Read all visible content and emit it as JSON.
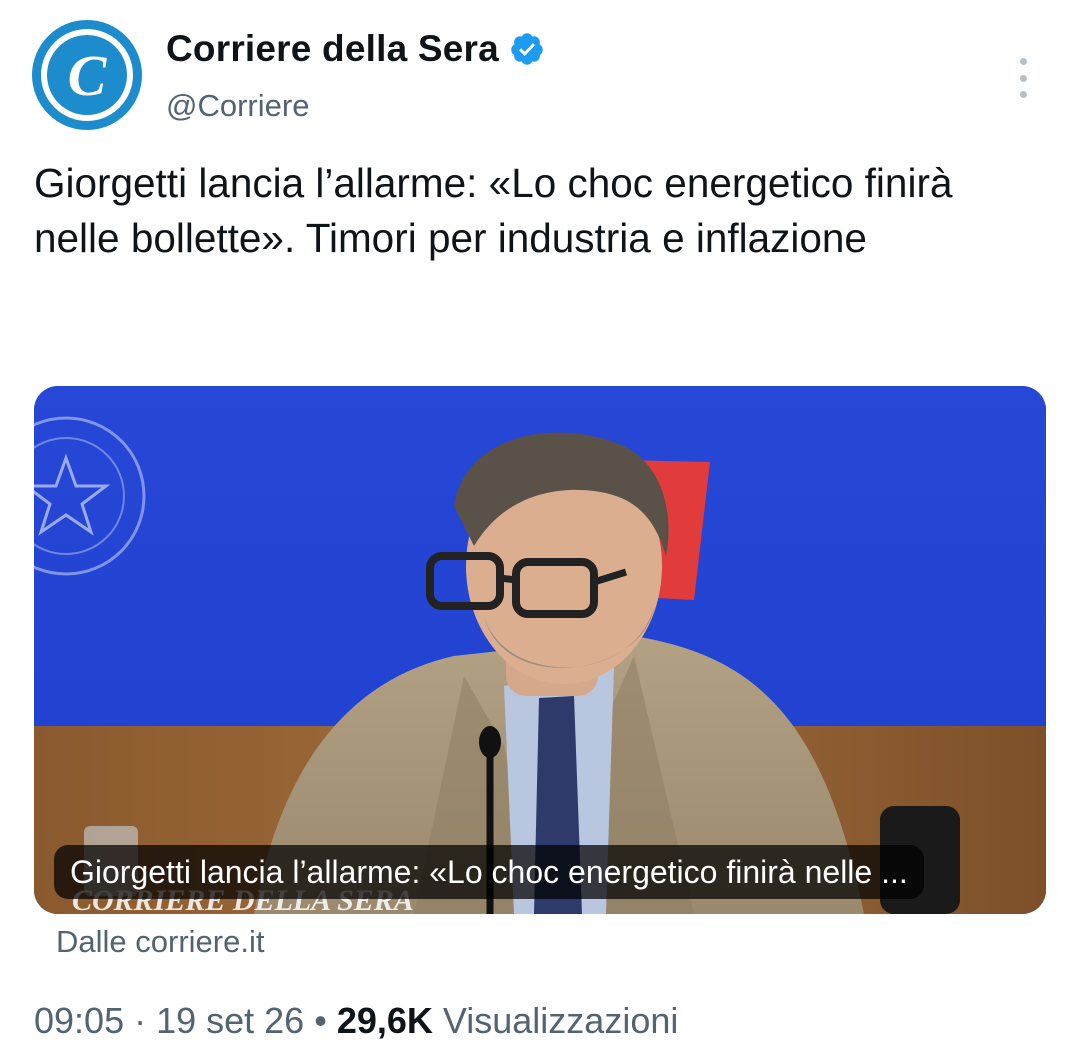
{
  "account": {
    "display_name": "Corriere della Sera",
    "handle": "@Corriere",
    "avatar_letter": "C",
    "brand_color": "#1d8ccd",
    "verified_color": "#1d9bf0"
  },
  "tweet": {
    "text": "Giorgetti lancia l’allarme: «Lo choc energetico finirà nelle bollette». Timori per industria e inflazione"
  },
  "card": {
    "caption": "Giorgetti lancia l’allarme: «Lo choc energetico finirà nelle ...",
    "source": "Dalle corriere.it",
    "watermark": "CORRIERE DELLA SERA"
  },
  "meta": {
    "time": "09:05",
    "sep1": " · ",
    "date": "19 set 26",
    "sep2": " • ",
    "views_count": "29,6K",
    "views_label": " Visualizzazioni"
  },
  "icons": {
    "more": "more-vertical-icon",
    "verified": "verified-badge-icon"
  }
}
